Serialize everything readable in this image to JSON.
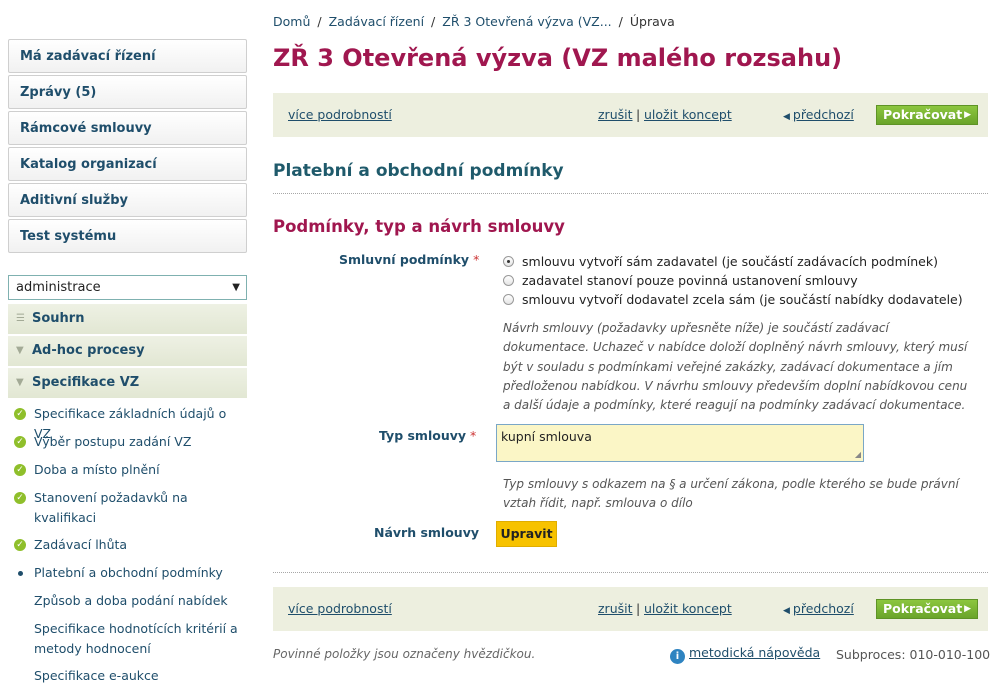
{
  "breadcrumb": [
    {
      "label": "Domů"
    },
    {
      "label": "Zadávací řízení"
    },
    {
      "label": "ZŘ 3 Otevřená výzva (VZ..."
    },
    {
      "label": "Úprava"
    }
  ],
  "page_title": "ZŘ 3 Otevřená výzva (VZ malého rozsahu)",
  "menu": [
    {
      "label": "Má zadávací řízení"
    },
    {
      "label": "Zprávy (5)"
    },
    {
      "label": "Rámcové smlouvy"
    },
    {
      "label": "Katalog organizací"
    },
    {
      "label": "Aditivní služby"
    },
    {
      "label": "Test systému"
    }
  ],
  "admin_select": {
    "value": "administrace"
  },
  "sections": {
    "summary": "Souhrn",
    "adhoc": "Ad-hoc procesy",
    "spec": "Specifikace VZ"
  },
  "spec_items": [
    {
      "label": "Specifikace základních údajů o VZ",
      "state": "done"
    },
    {
      "label": "Výběr postupu zadání VZ",
      "state": "done"
    },
    {
      "label": "Doba a místo plnění",
      "state": "done"
    },
    {
      "label": "Stanovení požadavků na kvalifikaci",
      "state": "done"
    },
    {
      "label": "Zadávací lhůta",
      "state": "done"
    },
    {
      "label": "Platební a obchodní podmínky",
      "state": "current"
    },
    {
      "label": "Způsob a doba podání nabídek",
      "state": "todo"
    },
    {
      "label": "Specifikace hodnotících kritérií a metody hodnocení",
      "state": "todo"
    },
    {
      "label": "Specifikace e-aukce",
      "state": "todo"
    }
  ],
  "action_bar": {
    "more_details": "více podrobností",
    "cancel": "zrušit",
    "separator": "|",
    "save_draft": "uložit koncept",
    "previous": "předchozí",
    "continue": "Pokračovat"
  },
  "section_heading": "Platební a obchodní podmínky",
  "subsection_heading": "Podmínky, typ a návrh smlouvy",
  "contract_terms": {
    "label": "Smluvní podmínky",
    "required_mark": "*",
    "options": [
      {
        "label": "smlouvu vytvoří sám zadavatel (je součástí zadávacích podmínek)",
        "selected": true
      },
      {
        "label": "zadavatel stanoví pouze povinná ustanovení smlouvy",
        "selected": false
      },
      {
        "label": "smlouvu vytvoří dodavatel zcela sám (je součástí nabídky dodavatele)",
        "selected": false
      }
    ],
    "help": "Návrh smlouvy (požadavky upřesněte níže) je součástí zadávací dokumentace. Uchazeč v nabídce doloží doplněný návrh smlouvy, který musí být v souladu s podmínkami veřejné zakázky, zadávací dokumentace a jím předloženou nabídkou. V návrhu smlouvy především doplní nabídkovou cenu a další údaje a podmínky, které reagují na podmínky zadávací dokumentace."
  },
  "contract_type": {
    "label": "Typ smlouvy",
    "required_mark": "*",
    "value": "kupní smlouva",
    "help": "Typ smlouvy s odkazem na § a určení zákona, podle kterého se bude právní vztah řídit, např. smlouva o dílo"
  },
  "contract_draft": {
    "label": "Návrh smlouvy",
    "button": "Upravit"
  },
  "footer": {
    "required_note": "Povinné položky jsou označeny hvězdičkou.",
    "help_link": "metodická nápověda",
    "subprocess": "Subproces: 010-010-100"
  },
  "colors": {
    "title": "#a0174f",
    "link": "#1f4e6b",
    "continue_button": "#78b233",
    "edit_button": "#f7c200",
    "bar_bg": "#edefdf",
    "input_bg": "#fbf6c6"
  }
}
